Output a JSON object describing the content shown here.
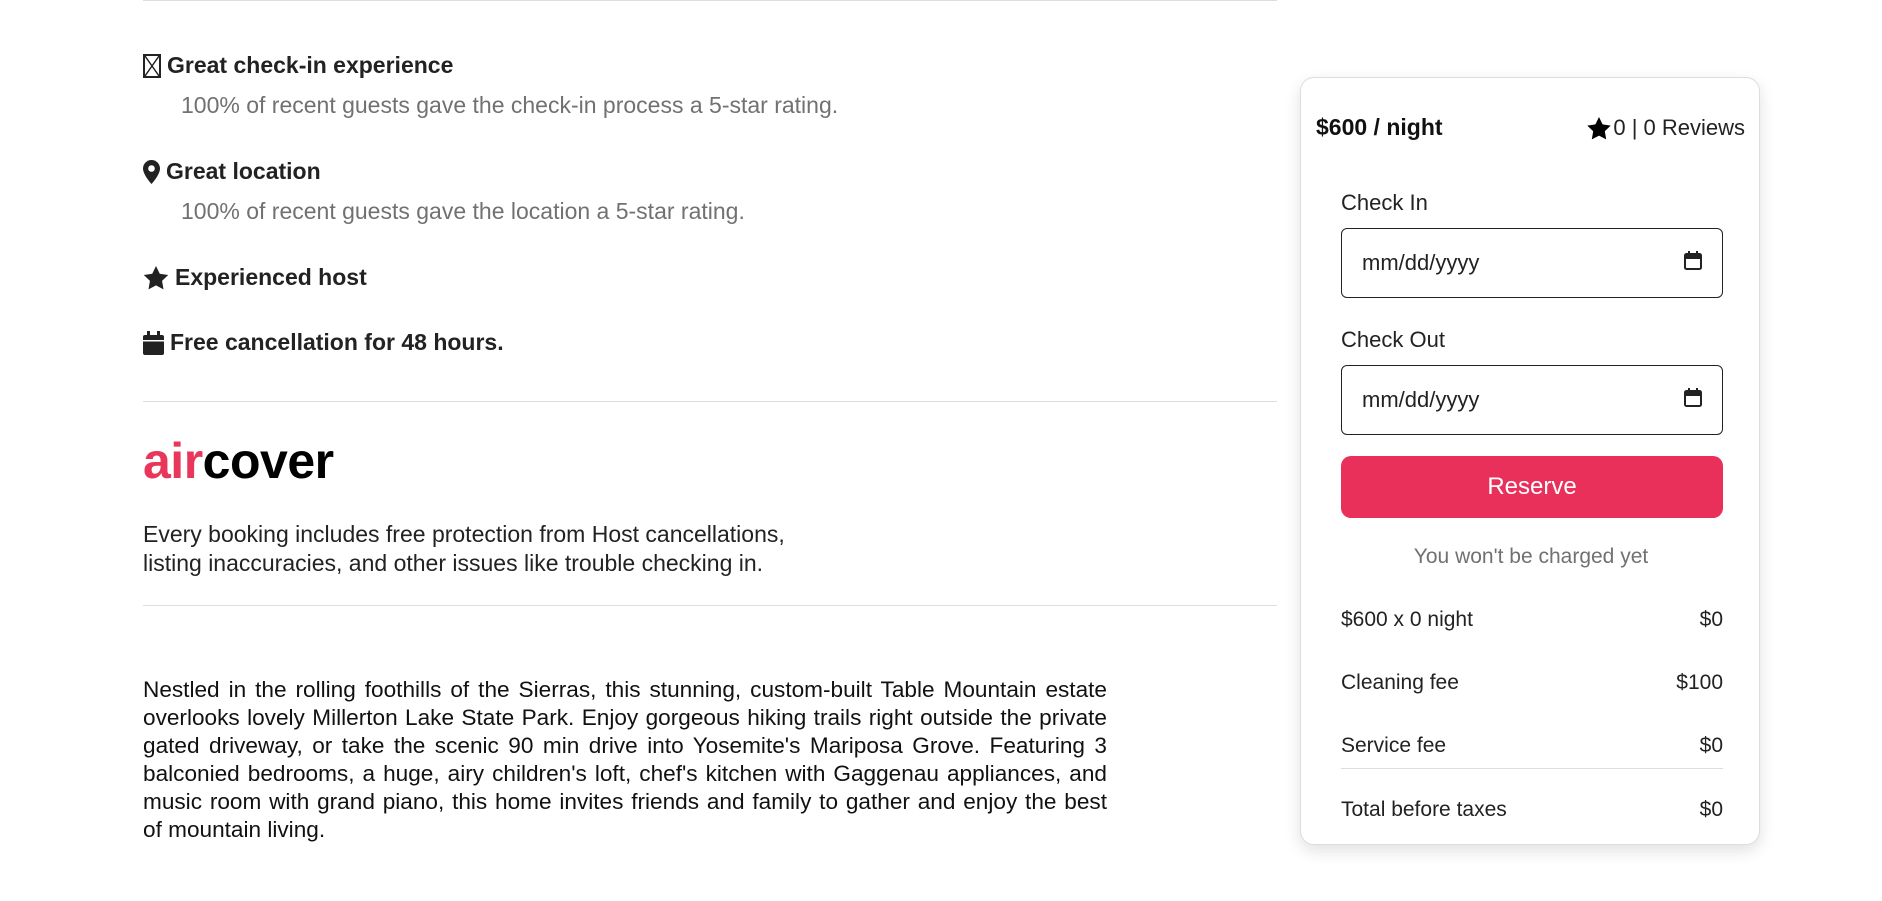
{
  "features": [
    {
      "icon": "door-icon",
      "title": "Great check-in experience",
      "desc": "100% of recent guests gave the check-in process a 5-star rating."
    },
    {
      "icon": "map-pin-icon",
      "title": "Great location",
      "desc": "100% of recent guests gave the location a 5-star rating."
    },
    {
      "icon": "star-icon",
      "title": "Experienced host"
    },
    {
      "icon": "calendar-icon",
      "title": "Free cancellation for 48 hours."
    }
  ],
  "aircover": {
    "brand_air": "air",
    "brand_cover": "cover",
    "line1": "Every booking includes free protection from Host cancellations,",
    "line2": "listing inaccuracies, and other issues like trouble checking in."
  },
  "description": "Nestled in the rolling foothills of the Sierras, this stunning, custom-built Table Mountain estate overlooks lovely Millerton Lake State Park. Enjoy gorgeous hiking trails right outside the private gated driveway, or take the scenic 90 min drive into Yosemite's Mariposa Grove. Featuring 3 balconied bedrooms, a huge, airy children's loft, chef's kitchen with Gaggenau appliances, and music room with grand piano, this home invites friends and family to gather and enjoy the best of mountain living.",
  "booking": {
    "price": "$600 / night",
    "rating": "0 | 0 Reviews",
    "check_in_label": "Check In",
    "check_in_placeholder": "mm/dd/yyyy",
    "check_out_label": "Check Out",
    "check_out_placeholder": "mm/dd/yyyy",
    "reserve_label": "Reserve",
    "note": "You won't be charged yet",
    "lines": [
      {
        "label": "$600 x 0 night",
        "amount": "$0"
      },
      {
        "label": "Cleaning fee",
        "amount": "$100"
      },
      {
        "label": "Service fee",
        "amount": "$0"
      }
    ],
    "total": {
      "label": "Total before taxes",
      "amount": "$0"
    }
  },
  "colors": {
    "brand": "#e8375a",
    "reserve": "#e8305a",
    "muted": "#717171"
  }
}
